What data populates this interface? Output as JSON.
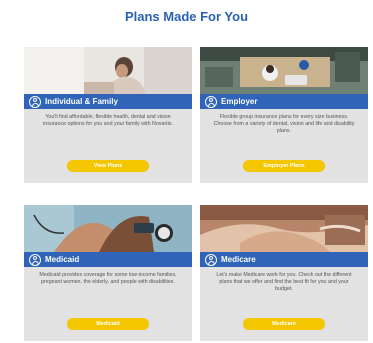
{
  "page": {
    "title": "Plans Made For You"
  },
  "colors": {
    "title": "#2a62b3",
    "band": "#2f64b9",
    "button": "#f4c600",
    "card_bg": "#e2e2e2"
  },
  "cards": [
    {
      "title": "Individual & Family",
      "icon": "person-icon",
      "description": "You'll find affordable, flexible health, dental and vision insurance options for you and your family with Novartis.",
      "button": "View Plans"
    },
    {
      "title": "Employer",
      "icon": "person-icon",
      "description": "Flexible group insurance plans for every size business. Choose from a variety of dental, vision and life and disability plans.",
      "button": "Employer Plans"
    },
    {
      "title": "Medicaid",
      "icon": "person-icon",
      "description": "Medicaid provides coverage for some low-income families, pregnant women, the elderly, and people with disabilities.",
      "button": "Medicaid"
    },
    {
      "title": "Medicare",
      "icon": "person-icon",
      "description": "Let's make Medicare work for you. Check out the different plans that we offer and find the best fit for you and your budget.",
      "button": "Medicare"
    }
  ]
}
